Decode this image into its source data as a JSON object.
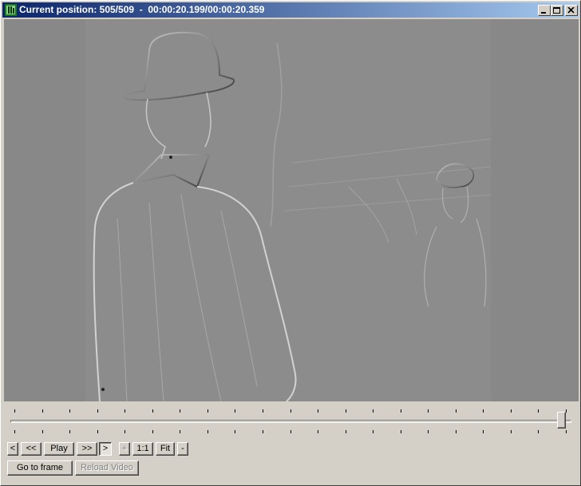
{
  "window": {
    "title": "Current position: 505/509  -  00:00:20.199/00:00:20.359",
    "minimize_icon": "minimize-icon",
    "maximize_icon": "maximize-icon",
    "close_icon": "close-icon"
  },
  "video": {
    "position_frame": 505,
    "total_frames": 509
  },
  "seek_slider": {
    "value_fraction": 0.992
  },
  "controls": {
    "prev_frame": "<",
    "rewind": "<<",
    "play": "Play",
    "fast_forward": ">>",
    "next_frame": ">",
    "zoom_in": "+",
    "zoom_1_1": "1:1",
    "fit": "Fit",
    "zoom_out": "-",
    "go_to_frame": "Go to frame",
    "reload_video": "Reload Video"
  },
  "colors": {
    "title_start": "#0a246a",
    "title_end": "#a6caf0",
    "face": "#d4d0c8",
    "video_bg": "#888888"
  }
}
